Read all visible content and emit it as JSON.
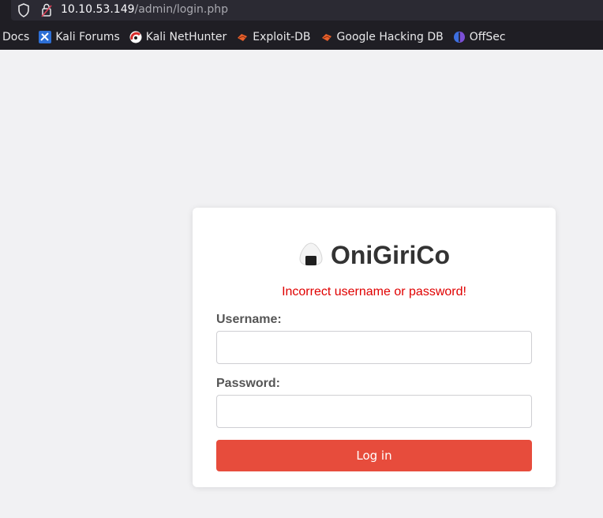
{
  "browser": {
    "url_host": "10.10.53.149",
    "url_path": "/admin/login.php",
    "bookmarks": [
      {
        "label": "Docs",
        "icon": "none"
      },
      {
        "label": "Kali Forums",
        "icon": "kali-forums-icon"
      },
      {
        "label": "Kali NetHunter",
        "icon": "kali-nethunter-icon"
      },
      {
        "label": "Exploit-DB",
        "icon": "exploit-db-icon"
      },
      {
        "label": "Google Hacking DB",
        "icon": "ghdb-icon"
      },
      {
        "label": "OffSec",
        "icon": "offsec-icon"
      }
    ]
  },
  "login": {
    "brand": "OniGiriCo",
    "logo_icon": "onigiri-icon",
    "error": "Incorrect username or password!",
    "username_label": "Username:",
    "username_value": "",
    "password_label": "Password:",
    "password_value": "",
    "submit_label": "Log in"
  },
  "colors": {
    "accent": "#e74c3c",
    "error": "#e00000",
    "page_bg": "#f1f1f3"
  }
}
